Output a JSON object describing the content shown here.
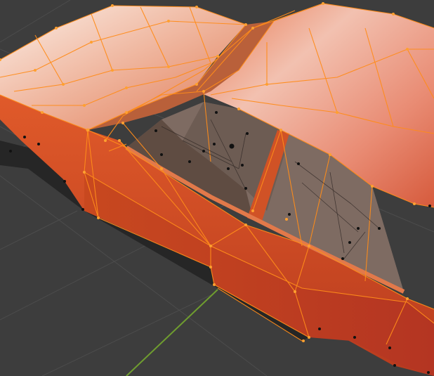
{
  "viewport": {
    "background": "#3d3d3d",
    "grid_color": "#4a4a4a",
    "y_axis_color": "#6f9d2f"
  },
  "model": {
    "mode": "edit",
    "selection_color": "#ff8c1a",
    "body_color": "#d84e26",
    "roof_highlight": "#f3d5c8",
    "interior_color": "#7a6a60",
    "glass_color": "#5a4a40",
    "shadow_color": "#262626",
    "vertex_selected": "#ffa030",
    "vertex_unselected": "#111111"
  }
}
